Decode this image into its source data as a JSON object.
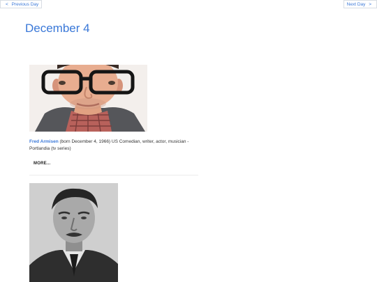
{
  "nav": {
    "prev_label": "Previous Day",
    "prev_arrow": "<",
    "next_label": "Next Day",
    "next_arrow": ">"
  },
  "page": {
    "title": "December 4"
  },
  "entries": [
    {
      "name": "Fred Armisen",
      "description": " (born December 4, 1966) US Comedian, writer, actor, musician - Portlandia (tv series)",
      "more_label": "MORE..."
    }
  ],
  "colors": {
    "accent": "#3a78d8",
    "text": "#333333",
    "border": "#d8dde3"
  }
}
